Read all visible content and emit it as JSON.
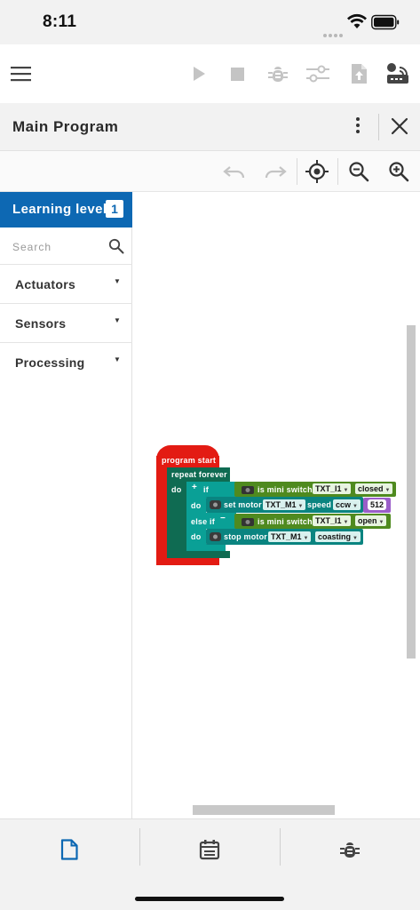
{
  "status_bar": {
    "time": "8:11"
  },
  "toolbar": {
    "icons": [
      "menu-icon",
      "play-icon",
      "stop-icon",
      "bug-icon",
      "sliders-icon",
      "upload-file-icon",
      "controller-wifi-icon"
    ]
  },
  "program_header": {
    "title": "Main Program"
  },
  "workspace_toolbar": {
    "icons": [
      "undo-icon",
      "redo-icon",
      "center-target-icon",
      "zoom-out-icon",
      "zoom-in-icon"
    ]
  },
  "palette": {
    "level_label": "Learning level",
    "level_number": "1",
    "search_placeholder": "Search",
    "categories": [
      {
        "label": "Actuators"
      },
      {
        "label": "Sensors"
      },
      {
        "label": "Processing"
      }
    ]
  },
  "program": {
    "start_label": "program start",
    "repeat_label": "repeat forever",
    "do_label": "do",
    "if_label": "if",
    "else_if_label": "else if",
    "if_do_label": "do",
    "else_do_label": "do",
    "plus_sign": "+",
    "minus_sign": "−",
    "condition1": {
      "label": "is mini switch",
      "port": "TXT_I1",
      "state": "closed"
    },
    "action1": {
      "label": "set motor",
      "port": "TXT_M1",
      "speed_label": "speed",
      "direction": "ccw",
      "speed_value": "512"
    },
    "condition2": {
      "label": "is mini switch",
      "port": "TXT_I1",
      "state": "open"
    },
    "action2": {
      "label": "stop motor",
      "port": "TXT_M1",
      "mode": "coasting"
    }
  },
  "bottom_nav": {
    "items": [
      "document-icon",
      "calendar-icon",
      "bug-icon"
    ],
    "active_index": 0
  },
  "colors": {
    "accent_blue": "#0d68b3",
    "program_start_red": "#e31b13",
    "loop_green": "#0f6b52",
    "logic_teal": "#0aa096",
    "sensor_green": "#4f8a1f",
    "motor_teal": "#0a8480",
    "number_purple": "#9b5ec9"
  }
}
